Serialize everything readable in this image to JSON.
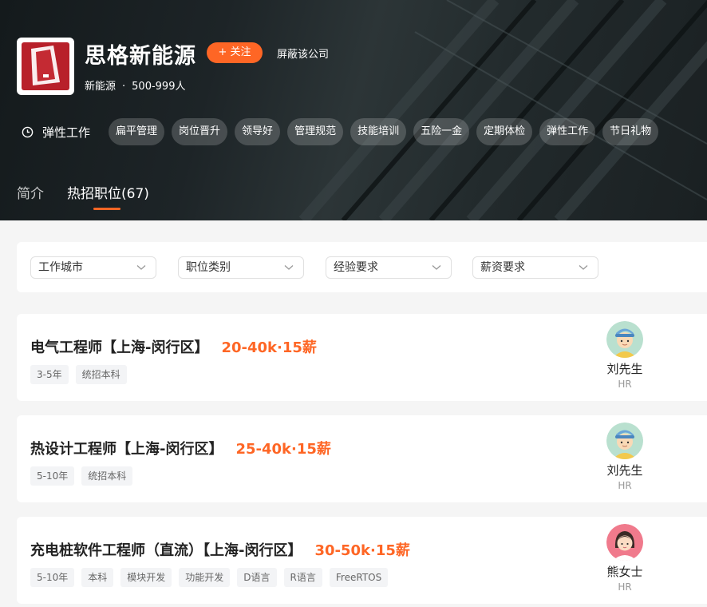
{
  "company": {
    "name": "思格新能源",
    "follow_label": "+ 关注",
    "block_label": "屏蔽该公司",
    "industry": "新能源",
    "separator": "·",
    "size": "500-999人"
  },
  "welfare": {
    "icon": "clock-icon",
    "label": "弹性工作",
    "tags": [
      "扁平管理",
      "岗位晋升",
      "领导好",
      "管理规范",
      "技能培训",
      "五险一金",
      "定期体检",
      "弹性工作",
      "节日礼物"
    ]
  },
  "tabs": [
    {
      "label": "简介",
      "active": false
    },
    {
      "label": "热招职位(67)",
      "active": true
    }
  ],
  "filters": [
    {
      "label": "工作城市"
    },
    {
      "label": "职位类别"
    },
    {
      "label": "经验要求"
    },
    {
      "label": "薪资要求"
    }
  ],
  "jobs": [
    {
      "title": "电气工程师【上海-闵行区】",
      "salary": "20-40k·15薪",
      "tags": [
        "3-5年",
        "统招本科"
      ],
      "hr_name": "刘先生",
      "hr_role": "HR",
      "avatar": "male-avatar"
    },
    {
      "title": "热设计工程师【上海-闵行区】",
      "salary": "25-40k·15薪",
      "tags": [
        "5-10年",
        "统招本科"
      ],
      "hr_name": "刘先生",
      "hr_role": "HR",
      "avatar": "male-avatar"
    },
    {
      "title": "充电桩软件工程师（直流）【上海-闵行区】",
      "salary": "30-50k·15薪",
      "tags": [
        "5-10年",
        "本科",
        "模块开发",
        "功能开发",
        "D语言",
        "R语言",
        "FreeRTOS"
      ],
      "hr_name": "熊女士",
      "hr_role": "HR",
      "avatar": "female-avatar"
    }
  ],
  "colors": {
    "accent": "#fe6625",
    "logo_red": "#b8202a"
  }
}
